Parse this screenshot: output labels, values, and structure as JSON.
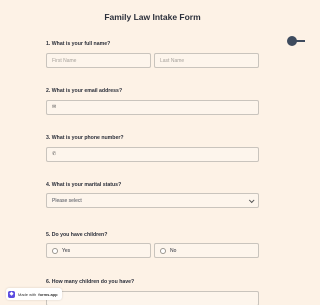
{
  "form": {
    "title": "Family Law Intake Form"
  },
  "questions": {
    "q1": {
      "label": "1. What is your full name?",
      "first_placeholder": "First Name",
      "last_placeholder": "Last Name"
    },
    "q2": {
      "label": "2. What is your email address?",
      "icon": "mail-icon"
    },
    "q3": {
      "label": "3. What is your phone number?",
      "icon": "phone-icon"
    },
    "q4": {
      "label": "4. What is your marital status?",
      "selected": "Please select"
    },
    "q5": {
      "label": "5. Do you have children?",
      "options": [
        "Yes",
        "No"
      ]
    },
    "q6": {
      "label": "6. How many children do you have?"
    }
  },
  "badge": {
    "prefix": "Made with",
    "brand": "forms.app"
  },
  "colors": {
    "background": "#fdf2e6",
    "text": "#2b2f3a",
    "border": "#c9c4bd",
    "toggle": "#3e4b5e",
    "brand": "#5b4ce0"
  }
}
